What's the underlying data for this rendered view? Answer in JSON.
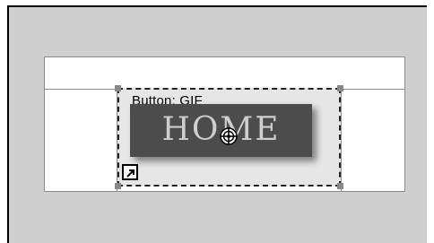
{
  "element": {
    "label": "Button: GIF",
    "button_text": "HOME"
  },
  "icons": {
    "cursor": "crosshair-globe-icon",
    "shortcut": "shortcut-arrow-icon"
  },
  "colors": {
    "frame_bg": "#cfcfcf",
    "button_bg": "#4c4c4c",
    "button_text": "#d5d5d5"
  }
}
